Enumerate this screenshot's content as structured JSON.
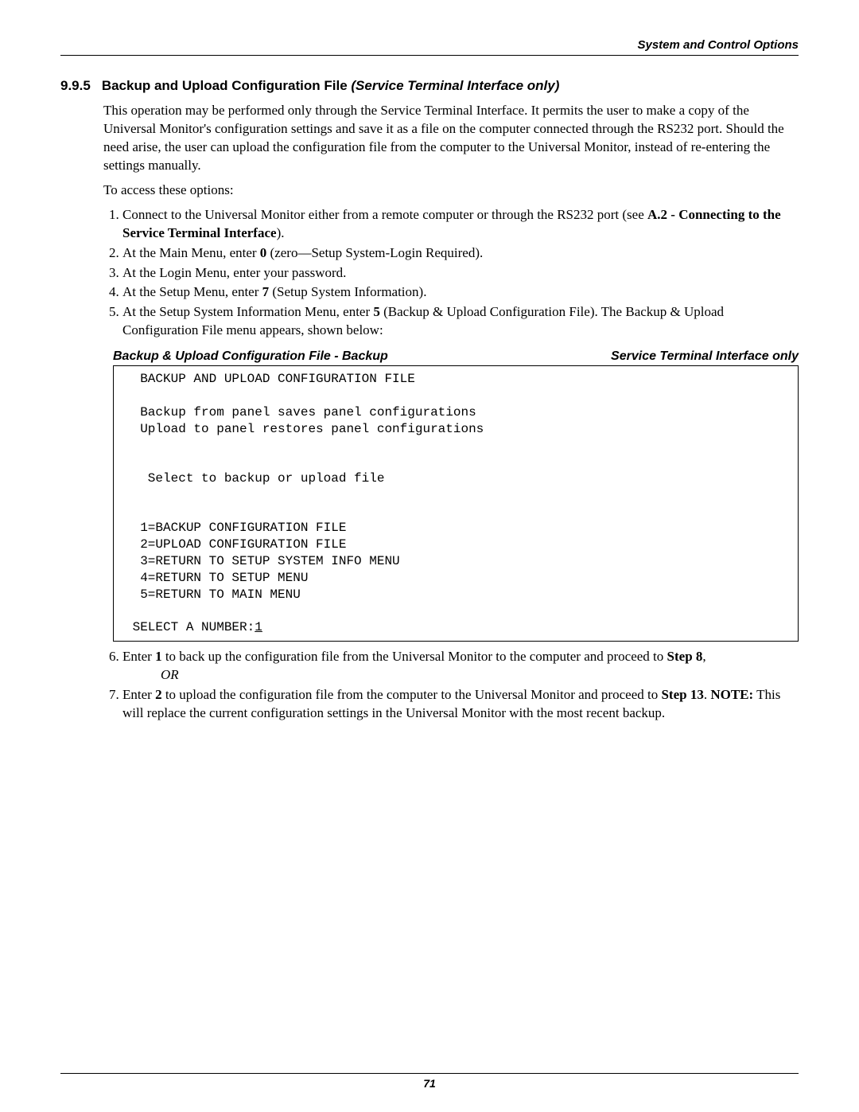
{
  "running_header": "System and Control Options",
  "section": {
    "number": "9.9.5",
    "title_plain": "Backup and Upload Configuration File ",
    "title_italic_suffix": "(Service Terminal Interface only)"
  },
  "intro_para": "This operation may be performed only through the Service Terminal Interface. It permits the user to make a copy of the Universal Monitor's configuration settings and save it as a file on the computer connected through the RS232 port. Should the need arise, the user can upload the configuration file from the computer to the Universal Monitor, instead of re-entering the settings manually.",
  "access_lead": "To access these options:",
  "steps_part1": {
    "s1_a": "Connect to the Universal Monitor either from a remote computer or through the RS232 port (see ",
    "s1_b_bold": "A.2 - Connecting to the Service Terminal Interface",
    "s1_c": ").",
    "s2_a": "At the Main Menu, enter ",
    "s2_b_bold": "0",
    "s2_c": " (zero—Setup System-Login Required).",
    "s3": "At the Login Menu, enter your password.",
    "s4_a": "At the Setup Menu, enter ",
    "s4_b_bold": "7",
    "s4_c": " (Setup System Information).",
    "s5_a": "At the Setup System Information Menu, enter ",
    "s5_b_bold": "5",
    "s5_c": " (Backup & Upload Configuration File). The Backup & Upload Configuration File menu appears, shown below:"
  },
  "caption": {
    "left": "Backup & Upload Configuration File - Backup",
    "right": "Service Terminal Interface only"
  },
  "terminal": {
    "l1": "  BACKUP AND UPLOAD CONFIGURATION FILE",
    "l2": "",
    "l3": "  Backup from panel saves panel configurations",
    "l4": "  Upload to panel restores panel configurations",
    "l5": "",
    "l6": "",
    "l7": "   Select to backup or upload file",
    "l8": "",
    "l9": "",
    "l10": "  1=BACKUP CONFIGURATION FILE",
    "l11": "  2=UPLOAD CONFIGURATION FILE",
    "l12": "  3=RETURN TO SETUP SYSTEM INFO MENU",
    "l13": "  4=RETURN TO SETUP MENU",
    "l14": "  5=RETURN TO MAIN MENU",
    "l15": "",
    "l16_a": " SELECT A NUMBER:",
    "l16_b_underline": "1"
  },
  "steps_part2": {
    "s6_a": "Enter ",
    "s6_b_bold": "1",
    "s6_c": " to back up the configuration file from the Universal Monitor to the computer and proceed to ",
    "s6_d_bold": "Step 8",
    "s6_e": ",",
    "or": "OR",
    "s7_a": "Enter ",
    "s7_b_bold": "2",
    "s7_c": " to upload the configuration file from the computer to the Universal Monitor and proceed to ",
    "s7_d_bold": "Step 13",
    "s7_e": ". ",
    "s7_f_bold": "NOTE:",
    "s7_g": " This will replace the current configuration settings in the Universal Monitor with the most recent backup."
  },
  "page_number": "71"
}
